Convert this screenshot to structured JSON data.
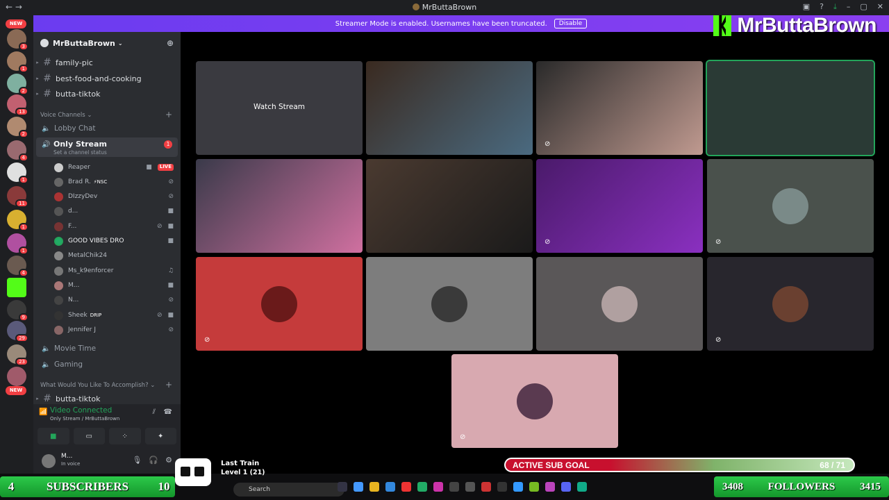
{
  "window": {
    "title": "MrButtaBrown"
  },
  "banner": {
    "text": "Streamer Mode is enabled. Usernames have been truncated.",
    "disable": "Disable"
  },
  "brand": {
    "name": "MrButtaBrown"
  },
  "servers": {
    "new_top": "NEW",
    "new_bottom": "NEW",
    "badges": [
      "3",
      "1",
      "2",
      "13",
      "2",
      "4",
      "1",
      "11",
      "1",
      "1",
      "4",
      "9",
      "29",
      "23"
    ]
  },
  "guild": {
    "name": "MrButtaBrown"
  },
  "channels": [
    "family-pic",
    "best-food-and-cooking",
    "butta-tiktok"
  ],
  "voice": {
    "section": "Voice Channels",
    "lobby": "Lobby Chat",
    "only_stream": "Only Stream",
    "only_status": "Set a channel status",
    "only_count": "1",
    "movie": "Movie Time",
    "gaming": "Gaming"
  },
  "members": [
    {
      "name": "Reaper",
      "tag": "",
      "live": "LIVE"
    },
    {
      "name": "Brad R.",
      "tag": "⚡NSC",
      "live": ""
    },
    {
      "name": "DIzzyDev",
      "tag": "",
      "live": ""
    },
    {
      "name": "d...",
      "tag": "",
      "live": ""
    },
    {
      "name": "F...",
      "tag": "",
      "live": ""
    },
    {
      "name": "GOOD VIBES DRO",
      "tag": "",
      "live": ""
    },
    {
      "name": "MetalChik24",
      "tag": "",
      "live": ""
    },
    {
      "name": "Ms_k9enforcer",
      "tag": "",
      "live": ""
    },
    {
      "name": "M...",
      "tag": "",
      "live": ""
    },
    {
      "name": "N...",
      "tag": "",
      "live": ""
    },
    {
      "name": "Sheek",
      "tag": "DRIP",
      "live": ""
    },
    {
      "name": "Jennifer J",
      "tag": "",
      "live": ""
    }
  ],
  "accomplish": {
    "section": "What Would You Like To Accomplish?",
    "channel": "butta-tiktok"
  },
  "voicebar": {
    "status": "Video Connected",
    "sub": "Only Stream / MrButtaBrown"
  },
  "user": {
    "name": "M...",
    "status": "In voice"
  },
  "grid": {
    "watch_stream": "Watch Stream"
  },
  "overlay": {
    "subs_left": "4",
    "subs_label": "SUBSCRIBERS",
    "subs_right": "10",
    "song": "Last Train",
    "level": "Level 1  (21)",
    "goal_label": "ACTIVE SUB GOAL",
    "goal_count": "68 / 71",
    "goal_progress": 0.958,
    "follow_left": "3408",
    "follow_label": "FOLLOWERS",
    "follow_right": "3415",
    "search": "Search"
  },
  "colors": {
    "accent": "#5865f2",
    "live": "#f23f43",
    "connected": "#23a55a",
    "kick": "#53fc18"
  }
}
